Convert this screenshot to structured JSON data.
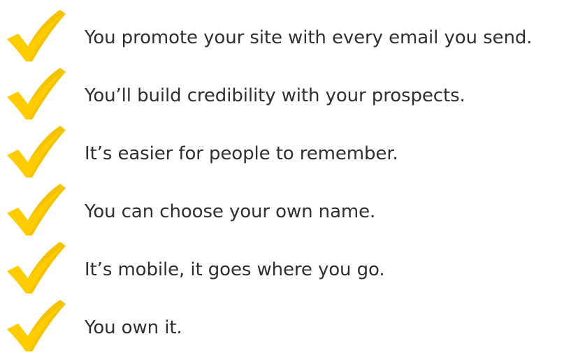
{
  "colors": {
    "check": "#ffcc00",
    "check_shadow": "#e0ae00",
    "text": "#2f2f2f",
    "background": "#ffffff"
  },
  "checklist": {
    "icon": "checkmark-icon",
    "items": [
      {
        "label": "You promote your site with every email you send."
      },
      {
        "label": "You’ll build credibility with your prospects."
      },
      {
        "label": "It’s easier for people to remember."
      },
      {
        "label": "You can choose your own name."
      },
      {
        "label": "It’s mobile, it goes where you go."
      },
      {
        "label": "You own it."
      }
    ]
  }
}
